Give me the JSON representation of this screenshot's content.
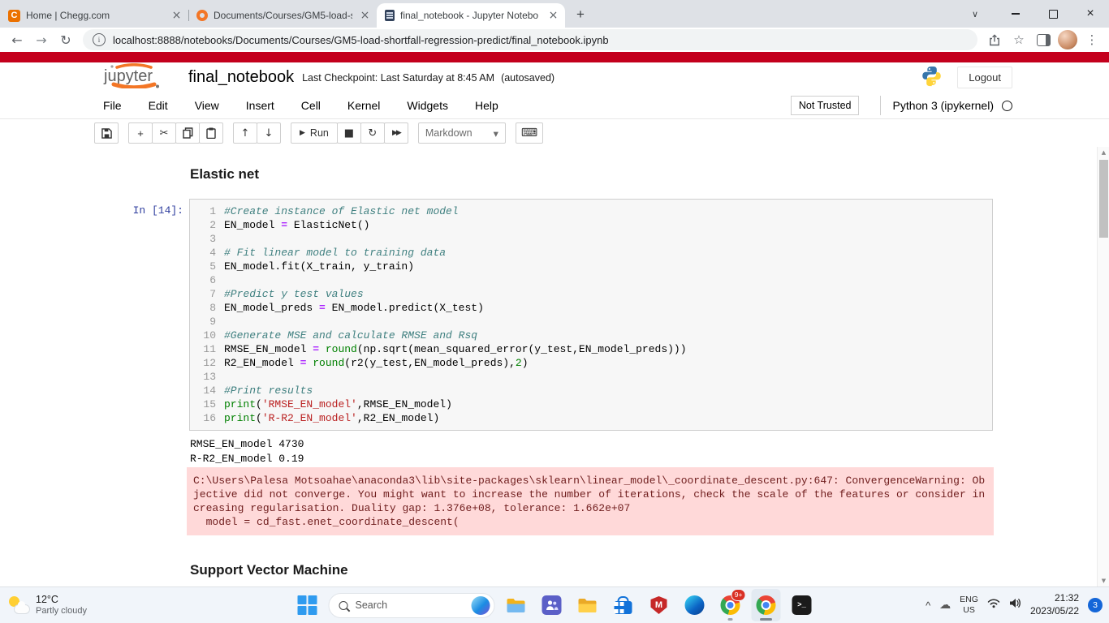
{
  "browser": {
    "tabs": [
      {
        "title": "Home | Chegg.com"
      },
      {
        "title": "Documents/Courses/GM5-load-s"
      },
      {
        "title": "final_notebook - Jupyter Notebo"
      }
    ],
    "url": "localhost:8888/notebooks/Documents/Courses/GM5-load-shortfall-regression-predict/final_notebook.ipynb"
  },
  "jupyter": {
    "logo_text": "jupyter",
    "title": "final_notebook",
    "checkpoint": "Last Checkpoint: Last Saturday at 8:45 AM",
    "autosaved": "(autosaved)",
    "logout": "Logout",
    "menu": [
      "File",
      "Edit",
      "View",
      "Insert",
      "Cell",
      "Kernel",
      "Widgets",
      "Help"
    ],
    "not_trusted": "Not Trusted",
    "kernel_name": "Python 3 (ipykernel)",
    "toolbar": {
      "run": "Run",
      "cell_type": "Markdown"
    }
  },
  "content": {
    "section1": "Elastic net",
    "section2": "Support Vector Machine",
    "prompt": "In [14]:",
    "code_lines": [
      [
        [
          "cm",
          "#Create instance of Elastic net model"
        ]
      ],
      [
        [
          "pl",
          "EN_model "
        ],
        [
          "op",
          "="
        ],
        [
          "pl",
          " ElasticNet()"
        ]
      ],
      [],
      [
        [
          "cm",
          "# Fit linear model to training data"
        ]
      ],
      [
        [
          "pl",
          "EN_model.fit(X_train, y_train)"
        ]
      ],
      [],
      [
        [
          "cm",
          "#Predict y test values"
        ]
      ],
      [
        [
          "pl",
          "EN_model_preds "
        ],
        [
          "op",
          "="
        ],
        [
          "pl",
          " EN_model.predict(X_test)"
        ]
      ],
      [],
      [
        [
          "cm",
          "#Generate MSE and calculate RMSE and Rsq"
        ]
      ],
      [
        [
          "pl",
          "RMSE_EN_model "
        ],
        [
          "op",
          "="
        ],
        [
          "pl",
          " "
        ],
        [
          "bi",
          "round"
        ],
        [
          "pl",
          "(np.sqrt(mean_squared_error(y_test,EN_model_preds)))"
        ]
      ],
      [
        [
          "pl",
          "R2_EN_model "
        ],
        [
          "op",
          "="
        ],
        [
          "pl",
          " "
        ],
        [
          "bi",
          "round"
        ],
        [
          "pl",
          "(r2(y_test,EN_model_preds),"
        ],
        [
          "nu",
          "2"
        ],
        [
          "pl",
          ")"
        ]
      ],
      [],
      [
        [
          "cm",
          "#Print results"
        ]
      ],
      [
        [
          "bi",
          "print"
        ],
        [
          "pl",
          "("
        ],
        [
          "st",
          "'RMSE_EN_model'"
        ],
        [
          "pl",
          ",RMSE_EN_model)"
        ]
      ],
      [
        [
          "bi",
          "print"
        ],
        [
          "pl",
          "("
        ],
        [
          "st",
          "'R-R2_EN_model'"
        ],
        [
          "pl",
          ",R2_EN_model)"
        ]
      ]
    ],
    "output_lines": [
      "RMSE_EN_model 4730",
      "R-R2_EN_model 0.19"
    ],
    "warning": {
      "message": "C:\\Users\\Palesa Motsoahae\\anaconda3\\lib\\site-packages\\sklearn\\linear_model\\_coordinate_descent.py:647: ConvergenceWarning: Objective did not converge. You might want to increase the number of iterations, check the scale of the features or consider increasing regularisation. Duality gap: 1.376e+08, tolerance: 1.662e+07",
      "code_line": "  model = cd_fast.enet_coordinate_descent("
    }
  },
  "taskbar": {
    "weather_temp": "12°C",
    "weather_desc": "Partly cloudy",
    "search_placeholder": "Search",
    "chrome_badge": "9+",
    "tray": {
      "lang_line1": "ENG",
      "lang_line2": "US",
      "time": "21:32",
      "date": "2023/05/22",
      "notif_count": "3"
    }
  },
  "icons": {
    "close": "×",
    "chevron_down": "∨",
    "back": "←",
    "forward": "→",
    "refresh": "↻",
    "info": "i",
    "add": "+",
    "cut": "✂",
    "up": "↑",
    "down": "↓",
    "run_glyph": "▶",
    "stop": "■",
    "restart": "↻",
    "fast_forward": "▶▶",
    "keyboard": "⌨",
    "select_caret": "▾",
    "star": "☆",
    "kebab": "⋮",
    "cloud": "☁",
    "tray_chevron": "^",
    "terminal_glyph": ">_",
    "mcafee_m": "M",
    "chegg_c": "C",
    "scroll_up": "▲",
    "scroll_down": "▼"
  },
  "colors": {
    "jupyter_orange": "#f37626",
    "warning_bg": "#ffd9d9",
    "red_banner": "#c4001d",
    "prompt_blue": "#303f9f",
    "comment_teal": "#408080",
    "string_red": "#ba2121",
    "builtin_green": "#008000"
  }
}
